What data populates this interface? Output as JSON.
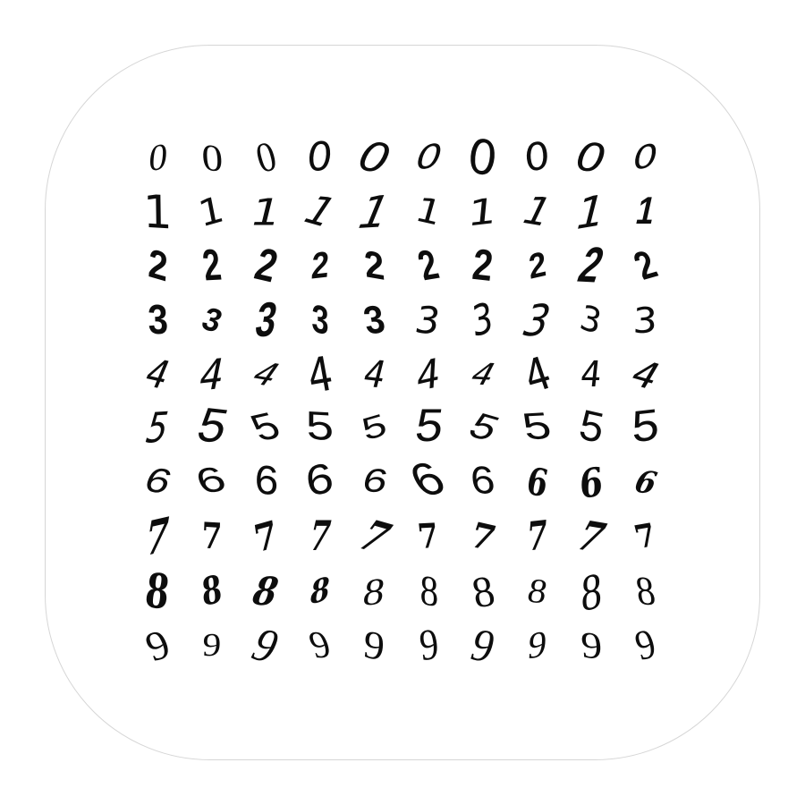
{
  "digit_grid": {
    "rows": [
      {
        "digit": "0",
        "cells": [
          "0",
          "0",
          "0",
          "0",
          "0",
          "0",
          "0",
          "0",
          "0",
          "0"
        ]
      },
      {
        "digit": "1",
        "cells": [
          "1",
          "1",
          "1",
          "1",
          "1",
          "1",
          "1",
          "1",
          "1",
          "1"
        ]
      },
      {
        "digit": "2",
        "cells": [
          "2",
          "2",
          "2",
          "2",
          "2",
          "2",
          "2",
          "2",
          "2",
          "2"
        ]
      },
      {
        "digit": "3",
        "cells": [
          "3",
          "3",
          "3",
          "3",
          "3",
          "3",
          "3",
          "3",
          "3",
          "3"
        ]
      },
      {
        "digit": "4",
        "cells": [
          "4",
          "4",
          "4",
          "4",
          "4",
          "4",
          "4",
          "4",
          "4",
          "4"
        ]
      },
      {
        "digit": "5",
        "cells": [
          "5",
          "5",
          "5",
          "5",
          "5",
          "5",
          "5",
          "5",
          "5",
          "5"
        ]
      },
      {
        "digit": "6",
        "cells": [
          "6",
          "6",
          "6",
          "6",
          "6",
          "6",
          "6",
          "6",
          "6",
          "6"
        ]
      },
      {
        "digit": "7",
        "cells": [
          "7",
          "7",
          "7",
          "7",
          "7",
          "7",
          "7",
          "7",
          "7",
          "7"
        ]
      },
      {
        "digit": "8",
        "cells": [
          "8",
          "8",
          "8",
          "8",
          "8",
          "8",
          "8",
          "8",
          "8",
          "8"
        ]
      },
      {
        "digit": "9",
        "cells": [
          "9",
          "9",
          "9",
          "9",
          "9",
          "9",
          "9",
          "9",
          "9",
          "9"
        ]
      }
    ]
  },
  "colors": {
    "background": "#ffffff",
    "tile_border": "#d6d6d6",
    "ink": "#0d0d0d"
  }
}
